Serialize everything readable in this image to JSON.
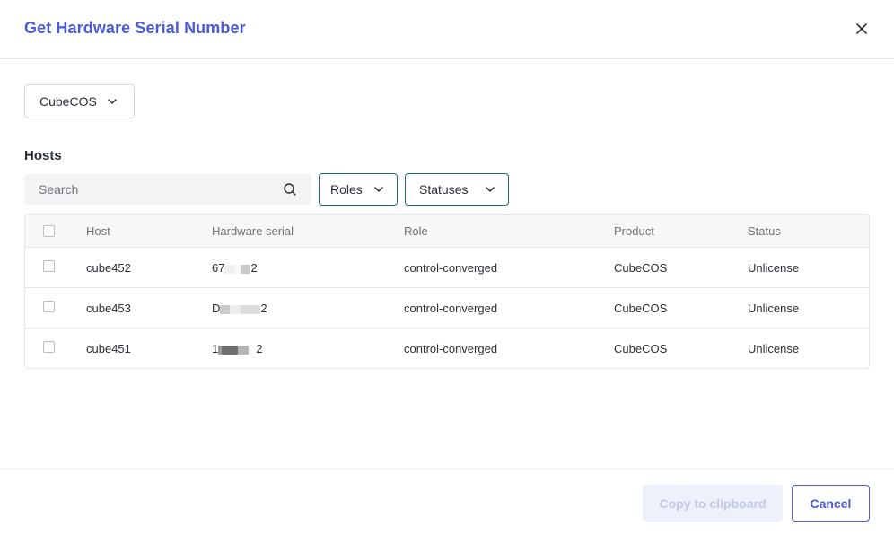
{
  "dialog": {
    "title": "Get Hardware Serial Number"
  },
  "product_select": {
    "value": "CubeCOS"
  },
  "hosts": {
    "label": "Hosts",
    "search_placeholder": "Search",
    "roles_label": "Roles",
    "statuses_label": "Statuses"
  },
  "table": {
    "headers": {
      "host": "Host",
      "serial": "Hardware serial",
      "role": "Role",
      "product": "Product",
      "status": "Status"
    },
    "rows": [
      {
        "host": "cube452",
        "serial_start": "67",
        "serial_end": "2",
        "role": "control-converged",
        "product": "CubeCOS",
        "status": "Unlicense"
      },
      {
        "host": "cube453",
        "serial_start": "D",
        "serial_end": "2",
        "role": "control-converged",
        "product": "CubeCOS",
        "status": "Unlicense"
      },
      {
        "host": "cube451",
        "serial_start": "1",
        "serial_end": "2",
        "role": "control-converged",
        "product": "CubeCOS",
        "status": "Unlicense"
      }
    ]
  },
  "footer": {
    "copy_label": "Copy to clipboard",
    "cancel_label": "Cancel"
  },
  "colors": {
    "accent": "#4a5bd4",
    "filter_border": "#1e6b72",
    "copy_disabled_bg": "#eef0fb"
  }
}
